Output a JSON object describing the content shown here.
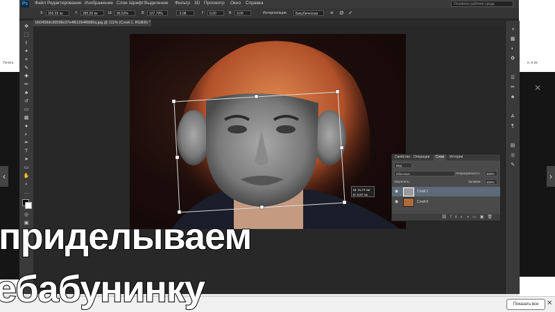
{
  "app": {
    "logo": "Ps",
    "menu": [
      "Файл",
      "Редактирование",
      "Изображение",
      "Слои",
      "Шрифт",
      "Выделение",
      "Фильтр",
      "3D",
      "Просмотр",
      "Окно",
      "Справка"
    ],
    "search_placeholder": "Основное рабочее среда"
  },
  "options_bar": {
    "x_label": "X:",
    "x_value": "355,55 пк",
    "y_label": "Y:",
    "y_value": "285,65 пк",
    "w_label": "Ш:",
    "w_value": "99,53%",
    "h_label": "В:",
    "h_value": "107,79%",
    "angle_value": "-3,08",
    "hskew_label": "Г:",
    "hskew_value": "0,00",
    "vskew_label": "В:",
    "vskew_value": "0,00",
    "interp_label": "Интерполяция:",
    "interp_value": "Бикубическая"
  },
  "document": {
    "tab_title": "b50458dc96598e37e4f61264f6886a.jpg @ 111% (Слой 1, RGB/8) *"
  },
  "transform_tooltip": {
    "w": "Ш: 11,74 см",
    "h": "В: 6,87 см"
  },
  "layers_panel": {
    "tabs": [
      "Свойства",
      "Операции",
      "Слои",
      "История"
    ],
    "kind_value": "Вид",
    "blend_mode": "Обычные",
    "opacity_label": "Непрозрачность:",
    "opacity_value": "100%",
    "lock_label": "Закрепить:",
    "fill_label": "Заливка:",
    "fill_value": "100%",
    "layers": [
      {
        "name": "Слой 1"
      },
      {
        "name": "Слой 0"
      }
    ]
  },
  "captions": {
    "line1": "приделываем",
    "line2": "ебабунинку"
  },
  "browser": {
    "show_all": "Показать все",
    "left_text": "Узнать",
    "right_text": "е, и их"
  },
  "colors": {
    "ps_bg": "#2a2a2a",
    "ps_accent": "#31a8ff",
    "selected_layer": "#5d6a7a"
  }
}
